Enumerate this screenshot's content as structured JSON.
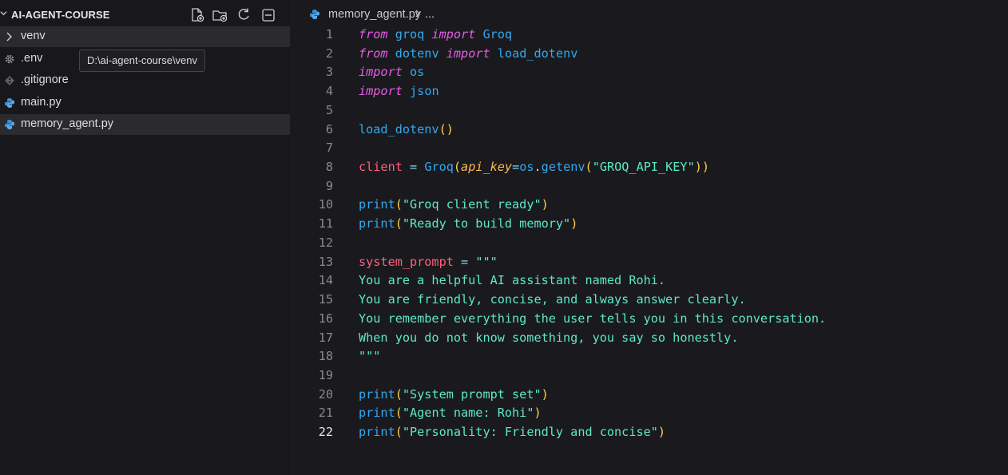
{
  "explorer": {
    "title": "AI-AGENT-COURSE",
    "actions": [
      "new-file-icon",
      "new-folder-icon",
      "refresh-icon",
      "collapse-all-icon"
    ],
    "items": [
      {
        "label": "venv",
        "icon": "chevron-right-icon"
      },
      {
        "label": ".env",
        "icon": "gear-icon"
      },
      {
        "label": ".gitignore",
        "icon": "git-icon"
      },
      {
        "label": "main.py",
        "icon": "python-icon"
      },
      {
        "label": "memory_agent.py",
        "icon": "python-icon"
      }
    ],
    "tooltip": "D:\\ai-agent-course\\venv"
  },
  "editor": {
    "breadcrumb_file": "memory_agent.py",
    "breadcrumb_more": "...",
    "current_line": 22,
    "lines": [
      [
        {
          "t": "from",
          "c": "kw"
        },
        {
          "t": " ",
          "c": "pl"
        },
        {
          "t": "groq",
          "c": "mod"
        },
        {
          "t": " ",
          "c": "pl"
        },
        {
          "t": "import",
          "c": "kw"
        },
        {
          "t": " ",
          "c": "pl"
        },
        {
          "t": "Groq",
          "c": "mod"
        }
      ],
      [
        {
          "t": "from",
          "c": "kw"
        },
        {
          "t": " ",
          "c": "pl"
        },
        {
          "t": "dotenv",
          "c": "mod"
        },
        {
          "t": " ",
          "c": "pl"
        },
        {
          "t": "import",
          "c": "kw"
        },
        {
          "t": " ",
          "c": "pl"
        },
        {
          "t": "load_dotenv",
          "c": "fn"
        }
      ],
      [
        {
          "t": "import",
          "c": "kw"
        },
        {
          "t": " ",
          "c": "pl"
        },
        {
          "t": "os",
          "c": "mod"
        }
      ],
      [
        {
          "t": "import",
          "c": "kw"
        },
        {
          "t": " ",
          "c": "pl"
        },
        {
          "t": "json",
          "c": "fn"
        }
      ],
      [],
      [
        {
          "t": "load_dotenv",
          "c": "fn"
        },
        {
          "t": "()",
          "c": "pn"
        }
      ],
      [],
      [
        {
          "t": "client",
          "c": "var"
        },
        {
          "t": " = ",
          "c": "op"
        },
        {
          "t": "Groq",
          "c": "fn"
        },
        {
          "t": "(",
          "c": "pn"
        },
        {
          "t": "api_key",
          "c": "par"
        },
        {
          "t": "=",
          "c": "op"
        },
        {
          "t": "os",
          "c": "mod"
        },
        {
          "t": ".",
          "c": "pl"
        },
        {
          "t": "getenv",
          "c": "fn"
        },
        {
          "t": "(",
          "c": "pn"
        },
        {
          "t": "\"GROQ_API_KEY\"",
          "c": "str"
        },
        {
          "t": "))",
          "c": "pn"
        }
      ],
      [],
      [
        {
          "t": "print",
          "c": "fn"
        },
        {
          "t": "(",
          "c": "pn"
        },
        {
          "t": "\"Groq client ready\"",
          "c": "str"
        },
        {
          "t": ")",
          "c": "pn"
        }
      ],
      [
        {
          "t": "print",
          "c": "fn"
        },
        {
          "t": "(",
          "c": "pn"
        },
        {
          "t": "\"Ready to build memory\"",
          "c": "str"
        },
        {
          "t": ")",
          "c": "pn"
        }
      ],
      [],
      [
        {
          "t": "system_prompt",
          "c": "var"
        },
        {
          "t": " = ",
          "c": "op"
        },
        {
          "t": "\"\"\"",
          "c": "str"
        }
      ],
      [
        {
          "t": "You are a helpful AI assistant named Rohi.",
          "c": "str"
        }
      ],
      [
        {
          "t": "You are friendly, concise, and always answer clearly.",
          "c": "str"
        }
      ],
      [
        {
          "t": "You remember everything the user tells you in this conversation.",
          "c": "str"
        }
      ],
      [
        {
          "t": "When you do not know something, you say so honestly.",
          "c": "str"
        }
      ],
      [
        {
          "t": "\"\"\"",
          "c": "str"
        }
      ],
      [],
      [
        {
          "t": "print",
          "c": "fn"
        },
        {
          "t": "(",
          "c": "pn"
        },
        {
          "t": "\"System prompt set\"",
          "c": "str"
        },
        {
          "t": ")",
          "c": "pn"
        }
      ],
      [
        {
          "t": "print",
          "c": "fn"
        },
        {
          "t": "(",
          "c": "pn"
        },
        {
          "t": "\"Agent name: Rohi\"",
          "c": "str"
        },
        {
          "t": ")",
          "c": "pn"
        }
      ],
      [
        {
          "t": "print",
          "c": "fn"
        },
        {
          "t": "(",
          "c": "pn"
        },
        {
          "t": "\"Personality: Friendly and concise\"",
          "c": "str"
        },
        {
          "t": ")",
          "c": "pn"
        }
      ]
    ]
  }
}
